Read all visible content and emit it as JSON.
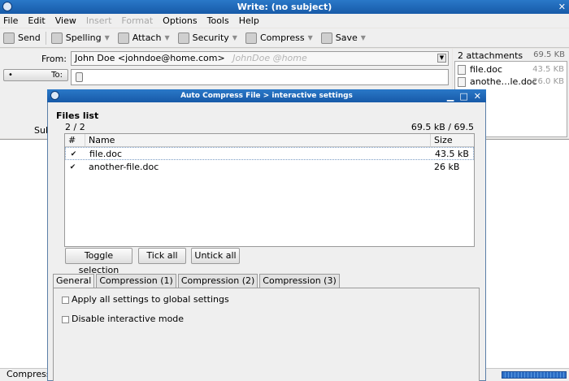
{
  "window": {
    "title": "Write: (no subject)"
  },
  "menu": [
    {
      "label": "File",
      "disabled": false
    },
    {
      "label": "Edit",
      "disabled": false
    },
    {
      "label": "View",
      "disabled": false
    },
    {
      "label": "Insert",
      "disabled": true
    },
    {
      "label": "Format",
      "disabled": true
    },
    {
      "label": "Options",
      "disabled": false
    },
    {
      "label": "Tools",
      "disabled": false
    },
    {
      "label": "Help",
      "disabled": false
    }
  ],
  "toolbar": {
    "send": "Send",
    "spelling": "Spelling",
    "attach": "Attach",
    "security": "Security",
    "compress": "Compress",
    "save": "Save"
  },
  "compose": {
    "from_label": "From:",
    "from_value": "John Doe <johndoe@home.com>",
    "from_hint": "JohnDoe @home",
    "to_label": "To:",
    "subject_label": "Sub"
  },
  "attachments": {
    "header": "2 attachments",
    "total": "69.5 KB",
    "items": [
      {
        "name": "file.doc",
        "size": "43.5 KB"
      },
      {
        "name": "anothe…le.doc",
        "size": "26.0 KB"
      }
    ]
  },
  "status": {
    "text": "Compressi",
    "progress": 1.0,
    "progress_color": "#2b6cc4"
  },
  "dialog": {
    "title": "Auto Compress File > interactive settings",
    "files_title": "Files list",
    "count": "2 / 2",
    "size": "69.5 kB / 69.5 kB",
    "columns": [
      "#",
      "Name",
      "Size"
    ],
    "rows": [
      {
        "checked": true,
        "name": "file.doc",
        "size": "43.5 kB"
      },
      {
        "checked": true,
        "name": "another-file.doc",
        "size": "26 kB"
      }
    ],
    "buttons": {
      "toggle": "Toggle selection",
      "tick": "Tick all",
      "untick": "Untick all"
    },
    "tabs": [
      "General",
      "Compression (1)",
      "Compression (2)",
      "Compression (3)"
    ],
    "active_tab": "General",
    "options": {
      "apply_all": "Apply all settings to global settings",
      "disable_interactive": "Disable interactive mode"
    }
  }
}
